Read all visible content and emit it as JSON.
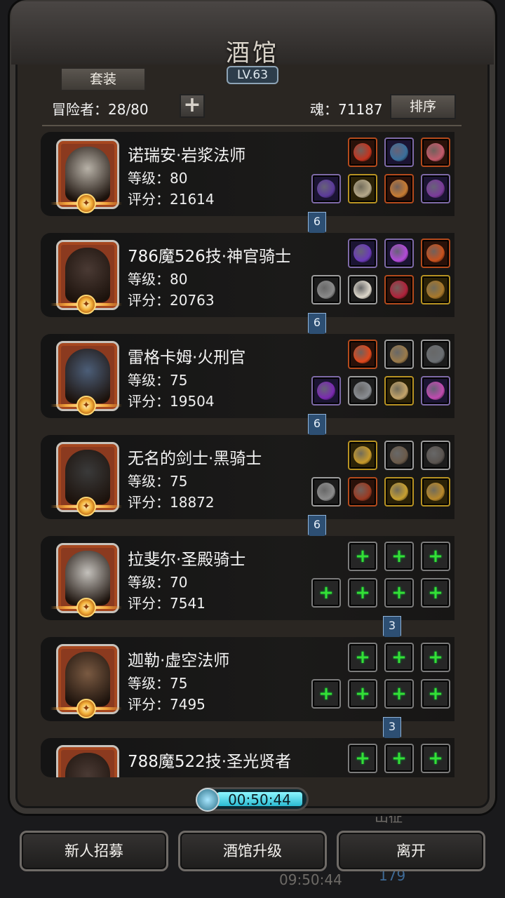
{
  "header": {
    "title": "酒馆",
    "level": "LV.63",
    "suit_button": "套装",
    "adventurer_count": "冒险者：28/80",
    "add_icon": "plus-icon",
    "soul": "魂：71187",
    "sort_button": "排序"
  },
  "heroes": [
    {
      "name": "诺瑞安·岩浆法师",
      "level": "等级：80",
      "score": "评分：21614",
      "portrait_color": "#b8b2a8",
      "link": "6",
      "top_equips": [
        "orange-red",
        "blue-dark",
        "orange-pink"
      ],
      "bottom_equips": [
        "purple",
        "yellow-tan",
        "orange",
        "purple-dark",
        "yellow-dark"
      ]
    },
    {
      "name": "786魔526技·神官骑士",
      "level": "等级：80",
      "score": "评分：20763",
      "portrait_color": "#4a3a34",
      "link": "6",
      "top_equips": [
        "purple-orb",
        "purple-gem",
        "orange-leaf"
      ],
      "bottom_equips": [
        "grey-hammer",
        "white-robe",
        "red-item",
        "yellow-ring"
      ]
    },
    {
      "name": "雷格卡姆·火刑官",
      "level": "等级：75",
      "score": "评分：19504",
      "portrait_color": "#4c5e78",
      "link": "6",
      "top_equips": [
        "fire",
        "wood-branch",
        "grey-stone"
      ],
      "bottom_equips": [
        "purple-staff",
        "grey-armor",
        "tan-bow",
        "purple-shield"
      ]
    },
    {
      "name": "无名的剑士·黑骑士",
      "level": "等级：75",
      "score": "评分：18872",
      "portrait_color": "#3a3a3a",
      "link": "6",
      "top_equips": [
        "gold-helmet",
        "dark-bow",
        "dark-blade"
      ],
      "bottom_equips": [
        "grey-sword",
        "red-armor",
        "gold-amulet",
        "gold-shield"
      ]
    },
    {
      "name": "拉斐尔·圣殿骑士",
      "level": "等级：70",
      "score": "评分：7541",
      "portrait_color": "#c4c1bc",
      "link": "3",
      "top_equips": [
        "empty",
        "empty",
        "empty"
      ],
      "bottom_equips": [
        "empty",
        "empty",
        "empty",
        "empty"
      ]
    },
    {
      "name": "迦勒·虚空法师",
      "level": "等级：75",
      "score": "评分：7495",
      "portrait_color": "#7a5a42",
      "link": "3",
      "top_equips": [
        "empty",
        "empty",
        "empty"
      ],
      "bottom_equips": [
        "empty",
        "empty",
        "empty",
        "empty"
      ]
    },
    {
      "name": "788魔522技·圣光贤者",
      "level": "",
      "score": "",
      "portrait_color": "#4a3a34",
      "link": "",
      "top_equips": [
        "empty",
        "empty",
        "empty"
      ],
      "bottom_equips": []
    }
  ],
  "timer": "00:50:44",
  "footer": {
    "recruit": "新人招募",
    "upgrade": "酒馆升级",
    "leave": "离开"
  },
  "background_text": {
    "expedition": "出征",
    "clock": "09:50:44",
    "count": "179"
  }
}
